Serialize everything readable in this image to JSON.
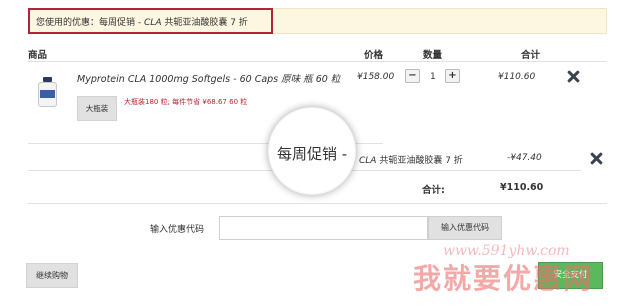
{
  "promo": {
    "prefix": "您使用的优惠：",
    "name": "每周促销",
    "sep": " - ",
    "product": "CLA",
    "desc": " 共轭亚油酸胶囊 7 折"
  },
  "table": {
    "headers": {
      "product": "商品",
      "price": "价格",
      "quantity": "数量",
      "subtotal": "合计"
    }
  },
  "cart_item": {
    "name": "Myprotein CLA 1000mg Softgels - 60 Caps 原味 瓶 60 粒",
    "variant": "大瓶装",
    "deal_note": "大瓶装180 粒; 每件节省 ¥68.67 60 粒",
    "price": "¥158.00",
    "qty_minus": "−",
    "qty": "1",
    "qty_plus": "+",
    "subtotal": "¥110.60"
  },
  "discount": {
    "product": "CLA",
    "desc": " 共轭亚油酸胶囊 7 折",
    "amount": "-¥47.40"
  },
  "total": {
    "label": "合计:",
    "value": "¥110.60"
  },
  "coupon": {
    "label": "输入优惠代码",
    "value": "",
    "button": "输入优惠代码"
  },
  "buttons": {
    "continue": "继续购物",
    "checkout": "安全支付"
  },
  "magnifier": {
    "text": "每周促销 -"
  },
  "watermark": {
    "url": "www.591yhw.com",
    "text": "我就要优惠网"
  },
  "colors": {
    "promo_border": "#b3213b",
    "promo_bg": "#fdf7e2",
    "deal_red": "#c4262e",
    "checkout_green": "#5cb85c",
    "button_gray": "#e1e1e1"
  },
  "icons": {
    "remove": "remove-x-icon",
    "product": "product-bottle-image"
  }
}
